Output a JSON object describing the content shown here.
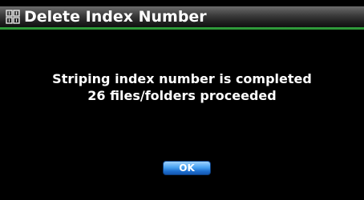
{
  "dialog": {
    "title": "Delete Index Number",
    "title_icon": "grid-menu-icon",
    "message_line1": "Striping index number is completed",
    "message_line2": "26 files/folders proceeded",
    "ok_label": "OK"
  },
  "colors": {
    "background": "#000000",
    "title_accent": "#2f9a3a",
    "button": "#3b8ee6",
    "text": "#ffffff"
  }
}
